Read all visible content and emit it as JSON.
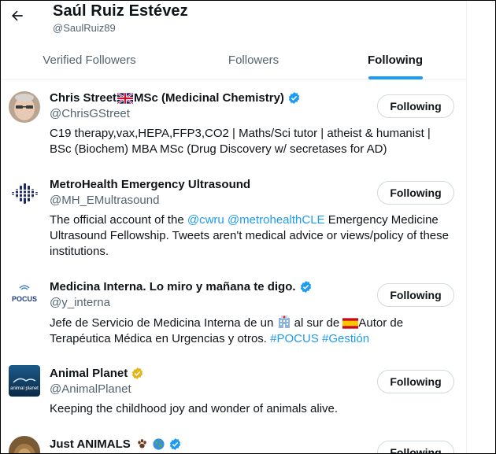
{
  "header": {
    "name": "Saúl Ruiz Estévez",
    "handle": "@SaulRuiz89"
  },
  "tabs": [
    {
      "label": "Verified Followers",
      "active": false
    },
    {
      "label": "Followers",
      "active": false
    },
    {
      "label": "Following",
      "active": true
    }
  ],
  "accounts": [
    {
      "name_part1": "Chris Street",
      "name_part2": "MSc (Medicinal Chemistry)",
      "handle": "@ChrisGStreet",
      "bio": "C19 therapy,vax,HEPA,FFP3,CO2 | Maths/Sci tutor | atheist & humanist | BSc (Biochem) MBA MSc (Drug Discovery w/ secretases for AD)",
      "button": "Following",
      "verified": "blue"
    },
    {
      "name": "MetroHealth Emergency Ultrasound",
      "handle": "@MH_EMultrasound",
      "bio_pre": "The official account of the ",
      "bio_link1": "@cwru",
      "bio_mid": " ",
      "bio_link2": "@metrohealthCLE",
      "bio_post": " Emergency Medicine Ultrasound Fellowship. Tweets aren't medical advice or views/policy of these institutions.",
      "button": "Following"
    },
    {
      "name": "Medicina Interna. Lo miro y mañana te digo.",
      "handle": "@y_interna",
      "avatar_text": "POCUS",
      "bio_pre": "Jefe de Servicio de Medicina Interna de un ",
      "bio_mid": " al sur de ",
      "bio_post": "Autor de Terapéutica Médica en Urgencias y otros. ",
      "bio_tag1": "#POCUS",
      "bio_tag2": "#Gestión",
      "button": "Following",
      "verified": "blue"
    },
    {
      "name": "Animal Planet",
      "handle": "@AnimalPlanet",
      "avatar_text": "animal planet",
      "bio": "Keeping the childhood joy and wonder of animals alive.",
      "button": "Following",
      "verified": "gold"
    },
    {
      "name": "Just ANIMALS",
      "button": "Following",
      "verified": "blue"
    }
  ],
  "colors": {
    "accent": "#1d9bf0",
    "text": "#0f1419",
    "secondary": "#536471",
    "border": "#cfd9de",
    "gold_badge": "#e2b719"
  },
  "icons": [
    "back-arrow-icon",
    "verified-badge-icon",
    "uk-flag-icon",
    "spain-flag-icon",
    "hospital-icon",
    "paw-prints-icon",
    "globe-icon"
  ]
}
